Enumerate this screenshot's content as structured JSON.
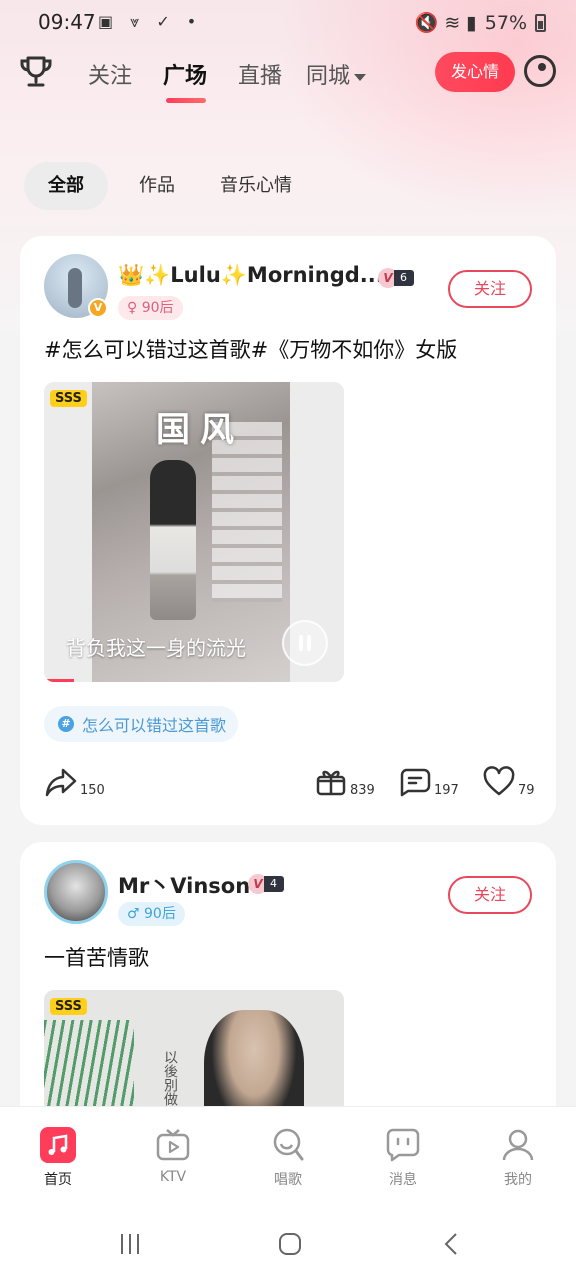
{
  "status_bar": {
    "time": "09:47",
    "left_icons": "▣ ⩔ ✓ •",
    "right_icons": "🔇 ≋ ▮",
    "battery": "57%"
  },
  "top_nav": {
    "tabs": [
      {
        "label": "关注"
      },
      {
        "label": "广场",
        "active": true
      },
      {
        "label": "直播"
      },
      {
        "label": "同城"
      }
    ],
    "post_button": "发心情"
  },
  "filters": [
    "全部",
    "作品",
    "音乐心情"
  ],
  "posts": [
    {
      "username": "👑✨Lulu✨Morningd...",
      "vip_badge": "V",
      "level": "6",
      "age_tag": "♀ 90后",
      "follow_label": "关注",
      "text": "#怎么可以错过这首歌#《万物不如你》女版",
      "media_badge": "SSS",
      "cover_title": "国风",
      "lyric": "背负我这一身的流光",
      "topic": "怎么可以错过这首歌",
      "topic_icon": "#",
      "share_count": "150",
      "gift_count": "839",
      "comment_count": "197",
      "like_count": "79"
    },
    {
      "username": "Mr丶Vinson",
      "vip_badge": "V",
      "level": "4",
      "age_tag": "♂ 90后",
      "follow_label": "关注",
      "text": "一首苦情歌",
      "media_badge": "SSS",
      "cover_text": "以後別做朋友"
    }
  ],
  "bottom_nav": [
    {
      "label": "首页",
      "active": true
    },
    {
      "label": "KTV"
    },
    {
      "label": "唱歌"
    },
    {
      "label": "消息"
    },
    {
      "label": "我的"
    }
  ],
  "accent_color": "#ff3d5a"
}
